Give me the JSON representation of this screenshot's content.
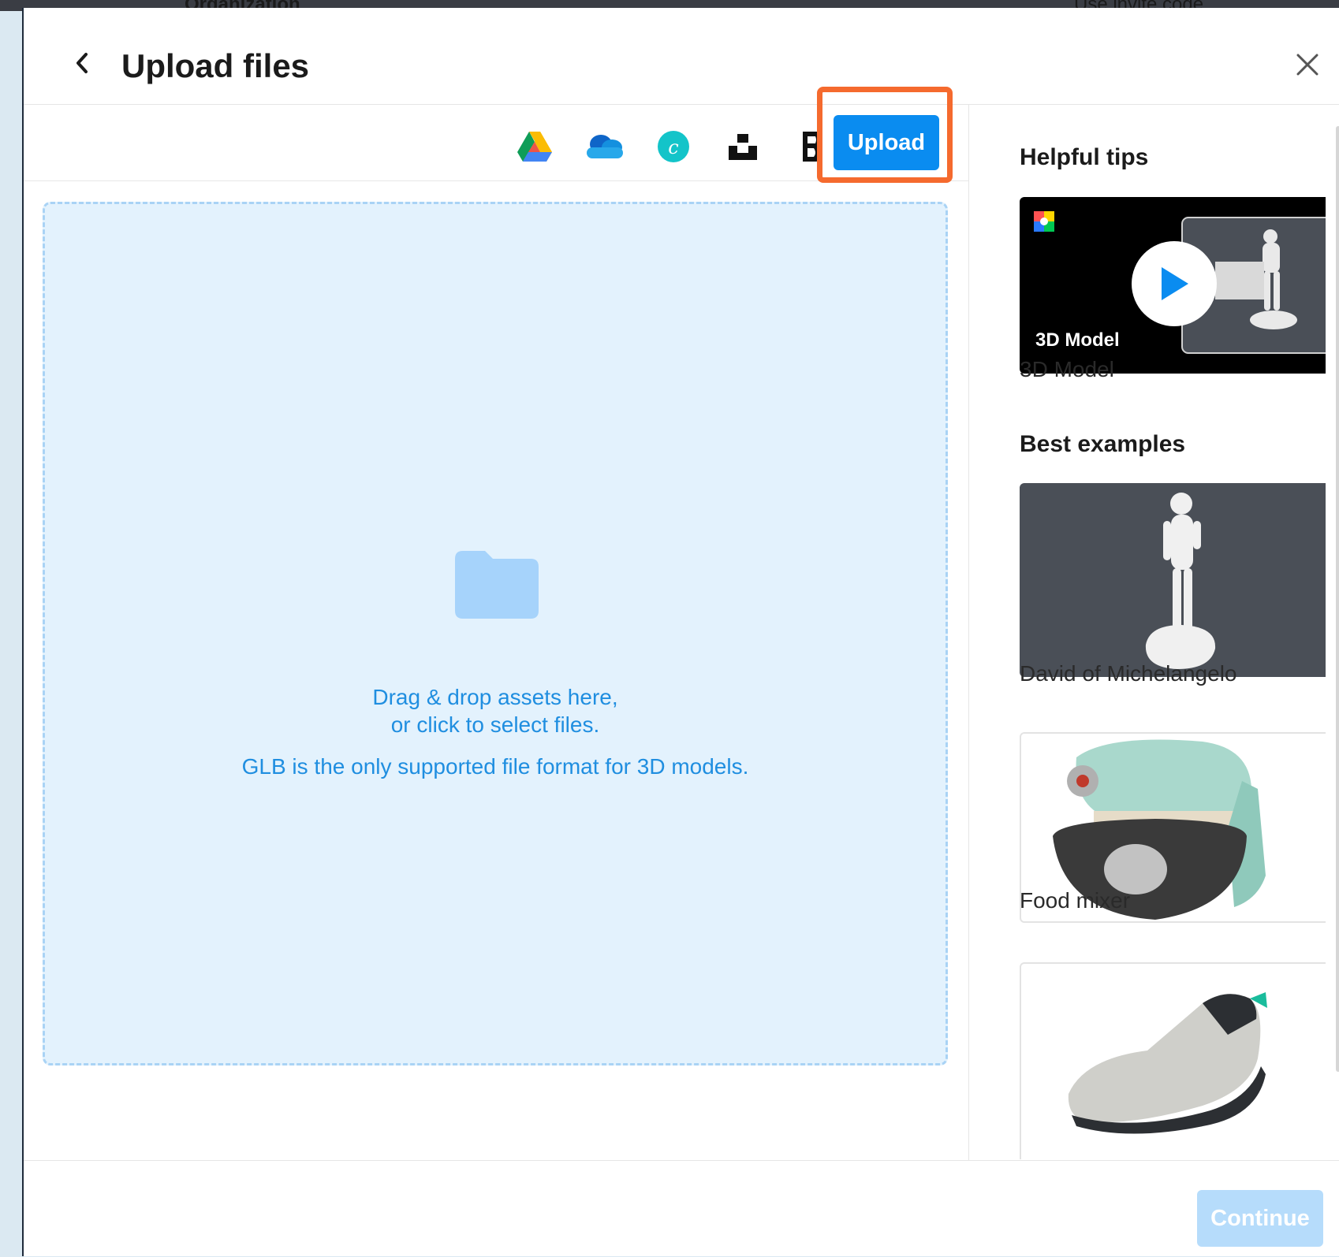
{
  "background": {
    "partial_text_left": "Organization",
    "partial_text_right": "Use invite code"
  },
  "header": {
    "title": "Upload files"
  },
  "toolbar": {
    "sources": [
      {
        "name": "google-drive-icon"
      },
      {
        "name": "onedrive-icon"
      },
      {
        "name": "canva-icon"
      },
      {
        "name": "unsplash-icon"
      },
      {
        "name": "box-icon"
      }
    ],
    "upload_label": "Upload",
    "highlight_color": "#f56a2e",
    "accent": "#0a8cf0"
  },
  "dropzone": {
    "line1": "Drag & drop assets here,",
    "line2": "or click to select files.",
    "line3": "GLB is the only supported file format for 3D models."
  },
  "sidebar": {
    "tips_title": "Helpful tips",
    "tip_video_overlay": "3D Model",
    "tip_caption": "3D Model",
    "examples_title": "Best examples",
    "examples": [
      {
        "caption": "David of Michelangelo"
      },
      {
        "caption": "Food mixer"
      },
      {
        "caption": ""
      }
    ]
  },
  "footer": {
    "continue_label": "Continue"
  }
}
